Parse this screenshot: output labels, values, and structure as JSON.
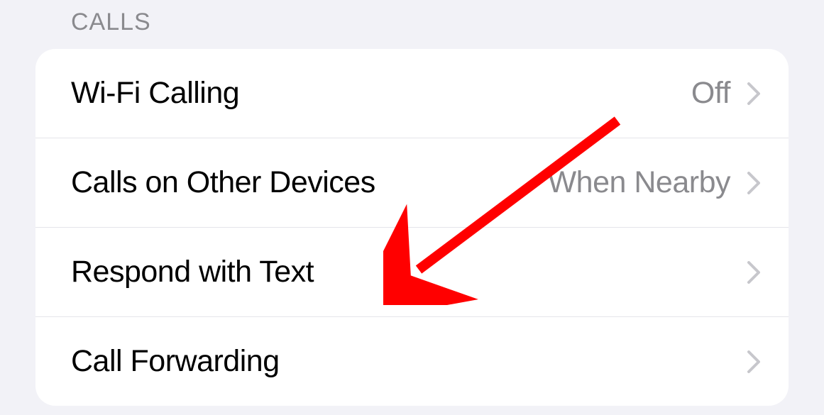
{
  "section": {
    "header": "CALLS"
  },
  "rows": [
    {
      "label": "Wi-Fi Calling",
      "value": "Off"
    },
    {
      "label": "Calls on Other Devices",
      "value": "When Nearby"
    },
    {
      "label": "Respond with Text",
      "value": ""
    },
    {
      "label": "Call Forwarding",
      "value": ""
    }
  ]
}
